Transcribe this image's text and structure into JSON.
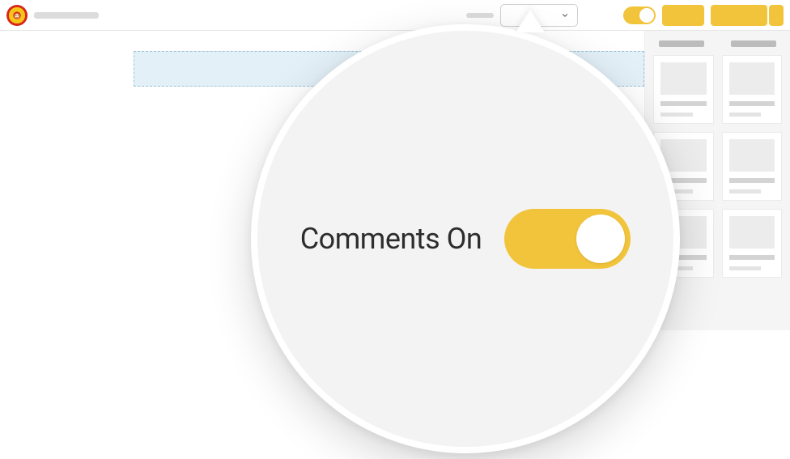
{
  "toolbar": {
    "dropdown_value": "",
    "comments_toggle_state": "on"
  },
  "magnifier": {
    "label": "Comments On",
    "toggle_state": "on"
  },
  "colors": {
    "accent": "#f2c43b",
    "highlight": "#e3f0f7"
  },
  "sidebar": {
    "cards_count": 6
  }
}
